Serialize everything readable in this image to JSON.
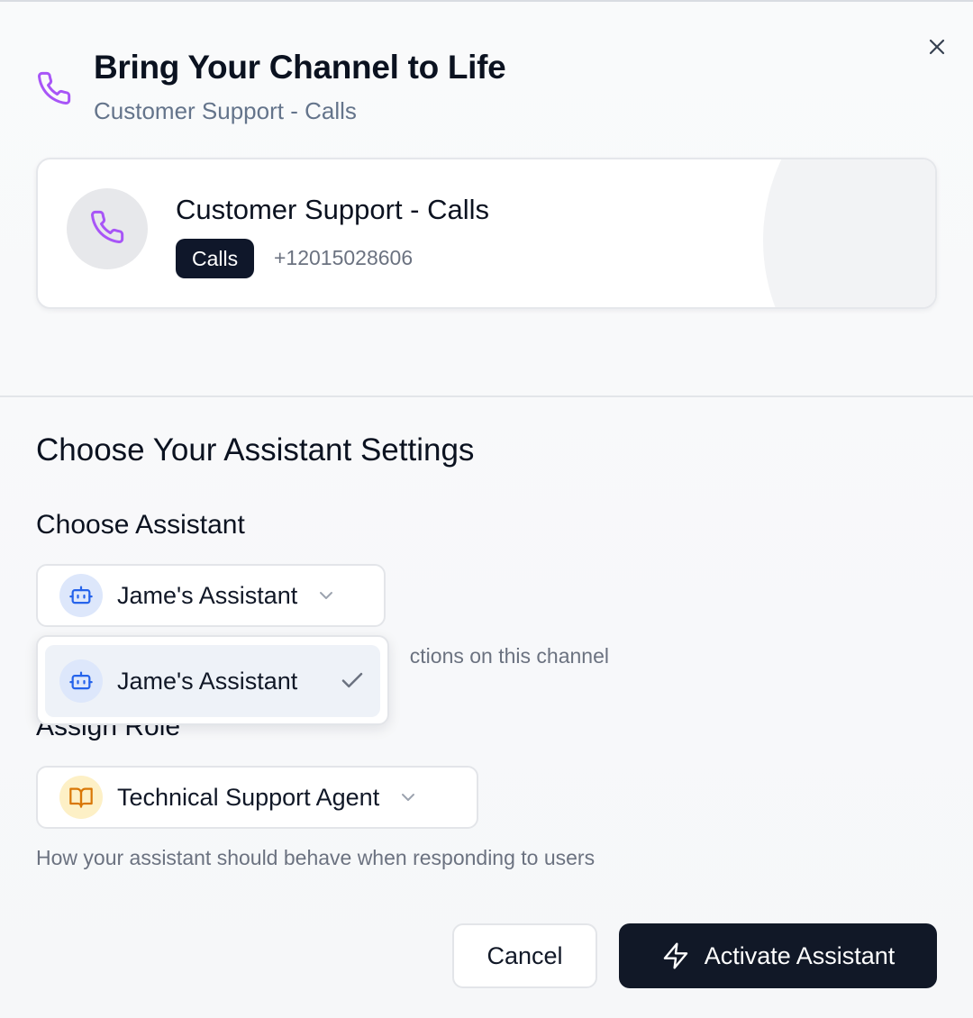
{
  "header": {
    "title": "Bring Your Channel to Life",
    "subtitle": "Customer Support - Calls",
    "icon": "phone-icon",
    "close_icon": "close-icon"
  },
  "channel_card": {
    "name": "Customer Support - Calls",
    "badge": "Calls",
    "phone": "+12015028606",
    "icon": "phone-icon"
  },
  "settings": {
    "section_title": "Choose Your Assistant Settings",
    "assistant": {
      "label": "Choose Assistant",
      "selected": "Jame's Assistant",
      "icon": "robot-icon",
      "help_text": "ctions on this channel",
      "options": [
        {
          "label": "Jame's Assistant",
          "selected": true
        }
      ]
    },
    "role": {
      "label": "Assign Role",
      "selected": "Technical Support Agent",
      "icon": "book-icon",
      "help_text": "How your assistant should behave when responding to users"
    }
  },
  "actions": {
    "cancel_label": "Cancel",
    "activate_label": "Activate Assistant",
    "activate_icon": "lightning-icon"
  },
  "colors": {
    "accent_purple": "#a855f7",
    "robot_blue": "#2563eb",
    "book_amber": "#d97706",
    "primary_dark": "#111827"
  }
}
